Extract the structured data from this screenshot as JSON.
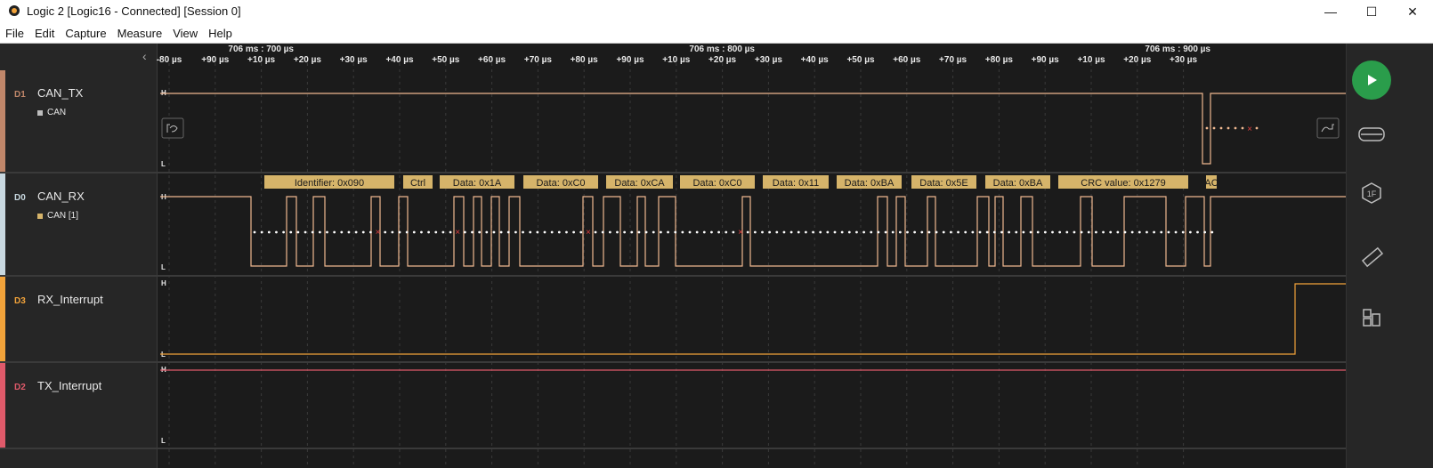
{
  "window": {
    "title": "Logic 2 [Logic16 - Connected] [Session 0]",
    "controls": {
      "minimize": "—",
      "maximize": "☐",
      "close": "✕"
    }
  },
  "menu": [
    "File",
    "Edit",
    "Capture",
    "Measure",
    "View",
    "Help"
  ],
  "timeline": {
    "major_labels": [
      "706 ms : 700 µs",
      "706 ms : 800 µs",
      "706 ms : 900 µs"
    ],
    "ticks": [
      "-80 µs",
      "+90 µs",
      "+10 µs",
      "+20 µs",
      "+30 µs",
      "+40 µs",
      "+50 µs",
      "+60 µs",
      "+70 µs",
      "+80 µs",
      "+90 µs",
      "+10 µs",
      "+20 µs",
      "+30 µs",
      "+40 µs",
      "+50 µs",
      "+60 µs",
      "+70 µs",
      "+80 µs",
      "+90 µs",
      "+10 µs",
      "+20 µs",
      "+30 µs"
    ]
  },
  "level_labels": {
    "high": "H",
    "low": "L"
  },
  "channels": [
    {
      "num": "D1",
      "name": "CAN_TX",
      "color": "#c0876a",
      "analyzer": "CAN",
      "analyzer_color": "#bdbdbd"
    },
    {
      "num": "D0",
      "name": "CAN_RX",
      "color": "#c8d8e0",
      "analyzer": "CAN [1]",
      "analyzer_color": "#d6b46a"
    },
    {
      "num": "D3",
      "name": "RX_Interrupt",
      "color": "#f2a33a",
      "analyzer": "",
      "analyzer_color": ""
    },
    {
      "num": "D2",
      "name": "TX_Interrupt",
      "color": "#e05a6a",
      "analyzer": "",
      "analyzer_color": ""
    }
  ],
  "frames": [
    "Identifier: 0x090",
    "Ctrl",
    "Data: 0x1A",
    "Data: 0xC0",
    "Data: 0xCA",
    "Data: 0xC0",
    "Data: 0x11",
    "Data: 0xBA",
    "Data: 0x5E",
    "Data: 0xBA",
    "CRC value: 0x1279",
    "AC"
  ],
  "colors": {
    "signal": "#f0b890",
    "frame_bg": "#d6b46a",
    "sample_dot": "#ffffff",
    "error_mark": "#e04040",
    "play": "#2a9d4b"
  },
  "icons": {
    "collapse": "chevron-left-icon",
    "prev_edge": "prev-edge-icon",
    "next_edge": "next-edge-icon",
    "play": "play-icon",
    "analyzers": "analyzers-icon",
    "extensions": "extensions-icon",
    "measure": "ruler-icon",
    "layout": "layout-icon"
  },
  "toolbar": {
    "extensions_badge": "1F"
  }
}
